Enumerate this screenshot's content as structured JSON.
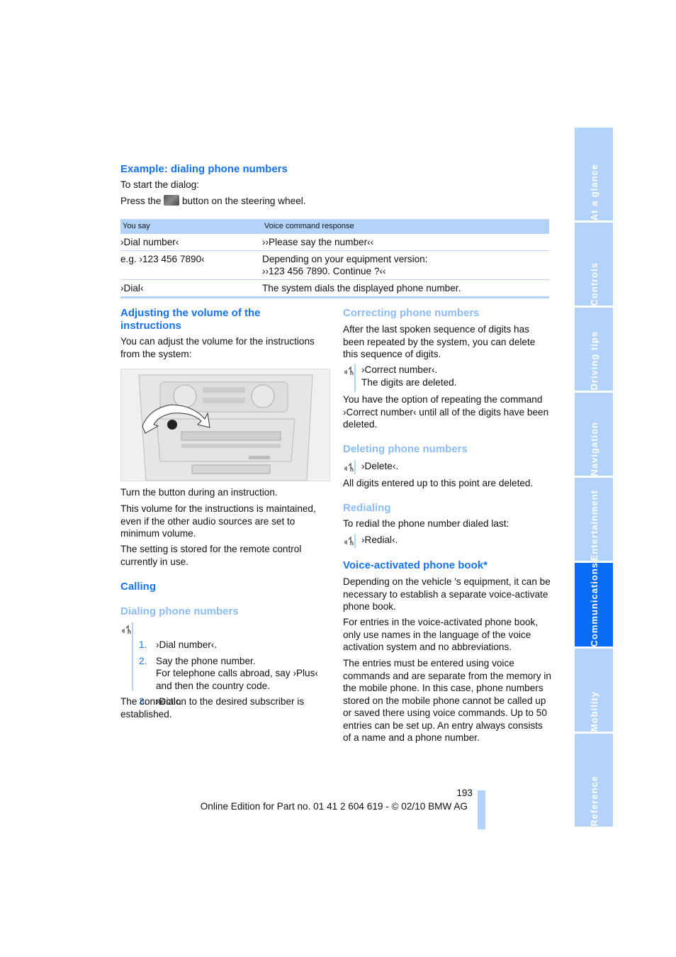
{
  "example": {
    "heading": "Example: dialing phone numbers",
    "intro": "To start the dialog:",
    "press_before": "Press the",
    "press_after": "button on the steering wheel.",
    "button_icon": "steering-wheel-voice-button-icon"
  },
  "table": {
    "headers": [
      "You say",
      "Voice command response"
    ],
    "rows": [
      {
        "say": "›Dial number‹",
        "response": [
          "››Please say the number‹‹"
        ]
      },
      {
        "say": "e.g. ›123 456 7890‹",
        "response": [
          "Depending on your equipment version:",
          "››123 456 7890. Continue ?‹‹"
        ]
      },
      {
        "say": "›Dial‹",
        "response": [
          "The system dials the displayed phone number."
        ]
      }
    ]
  },
  "volume": {
    "heading": "Adjusting the volume of the instructions",
    "intro": "You can adjust the volume for the instructions from the system:",
    "image_label": "center-console-volume-knob-illustration",
    "para1": "Turn the button during an instruction.",
    "para2": "This volume for the instructions is maintained, even if the other audio sources are set to minimum volume.",
    "para3": "The setting is stored for the remote control currently in use."
  },
  "calling": {
    "heading": "Calling",
    "subheading": "Dialing phone numbers",
    "steps": [
      {
        "num": "1.",
        "lines": [
          "›Dial number‹."
        ]
      },
      {
        "num": "2.",
        "lines": [
          "Say the phone number.",
          "For telephone calls abroad, say ›Plus‹ and then the country code."
        ]
      },
      {
        "num": "3.",
        "lines": [
          "›Dial‹."
        ]
      }
    ],
    "outro": "The connection to the desired subscriber is established."
  },
  "correcting": {
    "heading": "Correcting phone numbers",
    "intro": "After the last spoken sequence of digits has been repeated by the system, you can delete this sequence of digits.",
    "command": "›Correct number‹.",
    "result": "The digits are deleted.",
    "outro": "You have the option of repeating the command ›Correct number‹ until all of the digits have been deleted."
  },
  "deleting": {
    "heading": "Deleting phone numbers",
    "command": "›Delete‹.",
    "outro": "All digits entered up to this point are deleted."
  },
  "redialing": {
    "heading": "Redialing",
    "intro": "To redial the phone number dialed last:",
    "command": "›Redial‹."
  },
  "phonebook": {
    "heading": "Voice-activated phone book*",
    "para1": "Depending on the vehicle 's equipment, it can be necessary to establish a separate voice-activate phone book.",
    "para2": "For entries in the voice-activated phone book, only use names in the language of the voice activation system and no abbreviations.",
    "para3": "The entries must be entered using voice commands and are separate from the memory in the mobile phone. In this case, phone numbers stored on the mobile phone cannot be called up or saved there using voice commands. Up to 50 entries can be set up. An entry always consists of a name and a phone number."
  },
  "footer": {
    "page_number": "193",
    "edition": "Online Edition for Part no. 01 41 2 604 619 - © 02/10 BMW AG"
  },
  "tabs": [
    {
      "label": "At a glance",
      "active": false
    },
    {
      "label": "Controls",
      "active": false
    },
    {
      "label": "Driving tips",
      "active": false
    },
    {
      "label": "Navigation",
      "active": false
    },
    {
      "label": "Entertainment",
      "active": false
    },
    {
      "label": "Communications",
      "active": true
    },
    {
      "label": "Mobility",
      "active": false
    },
    {
      "label": "Reference",
      "active": false
    }
  ],
  "colors": {
    "heading_dark": "#1672f0",
    "heading_light": "#8cbcf5",
    "tab_inactive": "#b3d3fa",
    "tab_active": "#0a6cf5"
  }
}
